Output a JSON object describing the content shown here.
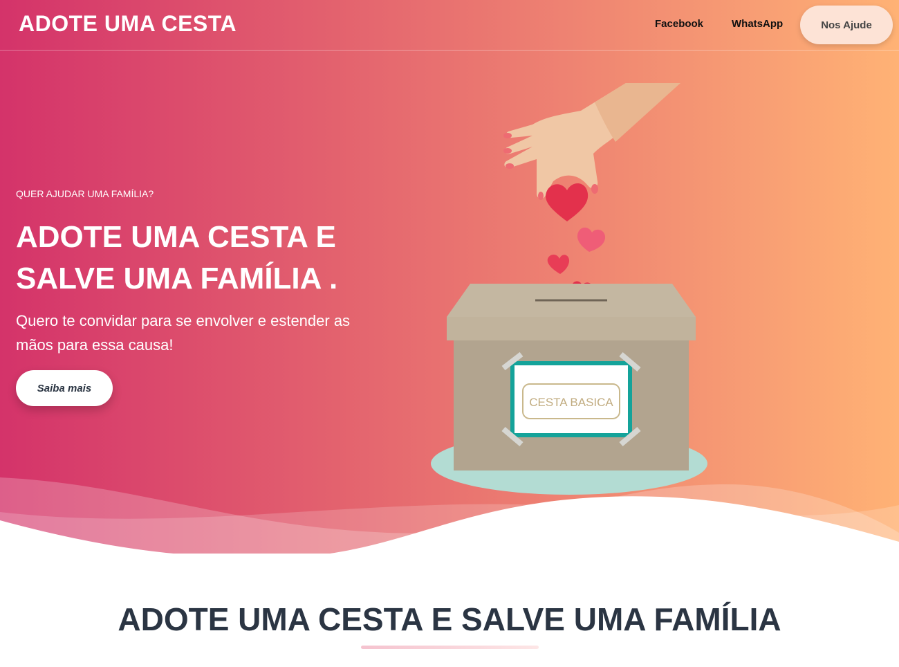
{
  "nav": {
    "brand": "ADOTE UMA CESTA",
    "links": [
      "Facebook",
      "WhatsApp"
    ],
    "cta": "Nos Ajude"
  },
  "hero": {
    "eyebrow": "QUER AJUDAR UMA FAMÍLIA?",
    "headline": "ADOTE UMA CESTA E SALVE UMA FAMÍLIA .",
    "lead": "Quero te convidar para se envolver e estender as mãos para essa causa!",
    "button": "Saiba mais",
    "box_label": "CESTA BASICA"
  },
  "section": {
    "title": "ADOTE UMA CESTA E SALVE UMA FAMÍLIA"
  },
  "colors": {
    "gradient_start": "#d4336a",
    "gradient_end": "#ffb275",
    "heading": "#2b3543"
  }
}
